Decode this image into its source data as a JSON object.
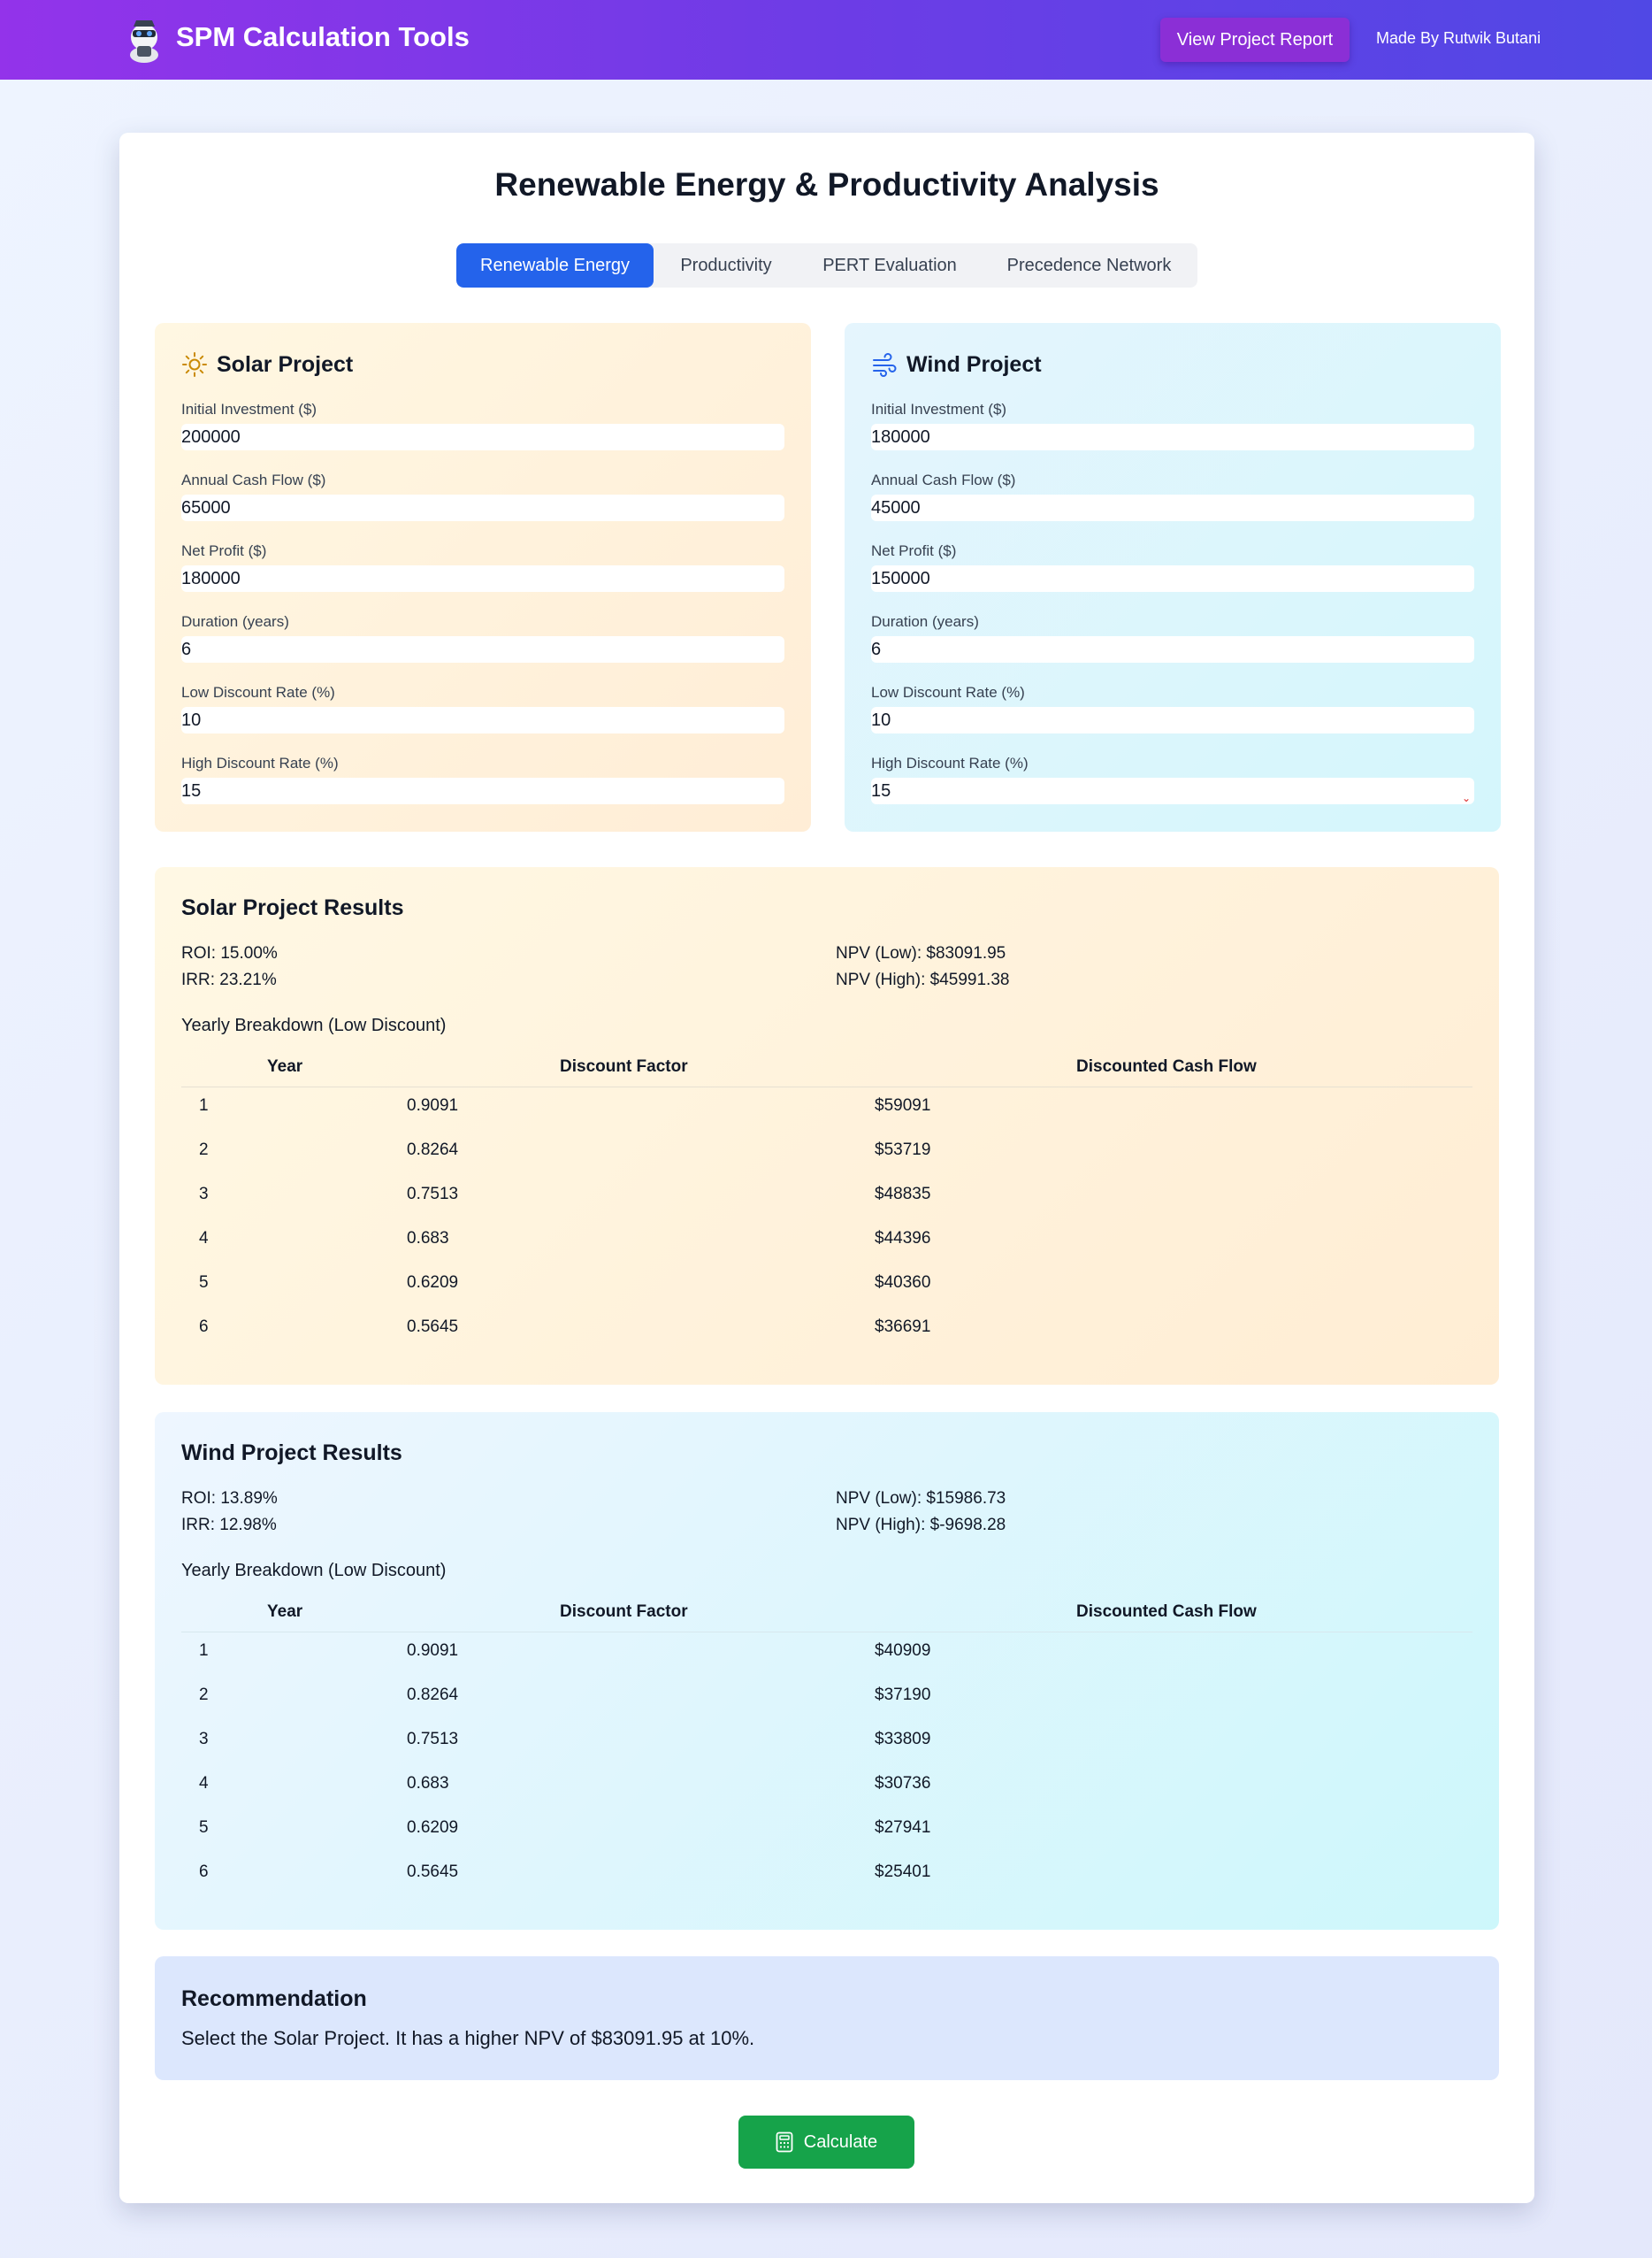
{
  "header": {
    "app_title": "SPM Calculation Tools",
    "report_button": "View Project Report",
    "made_by": "Made By Rutwik Butani"
  },
  "page_title": "Renewable Energy & Productivity Analysis",
  "tabs": [
    {
      "label": "Renewable Energy",
      "active": true
    },
    {
      "label": "Productivity",
      "active": false
    },
    {
      "label": "PERT Evaluation",
      "active": false
    },
    {
      "label": "Precedence Network",
      "active": false
    }
  ],
  "solar_input": {
    "title": "Solar Project",
    "icon": "sun-icon",
    "fields": [
      {
        "label": "Initial Investment ($)",
        "value": "200000"
      },
      {
        "label": "Annual Cash Flow ($)",
        "value": "65000"
      },
      {
        "label": "Net Profit ($)",
        "value": "180000"
      },
      {
        "label": "Duration (years)",
        "value": "6"
      },
      {
        "label": "Low Discount Rate (%)",
        "value": "10"
      },
      {
        "label": "High Discount Rate (%)",
        "value": "15"
      }
    ]
  },
  "wind_input": {
    "title": "Wind Project",
    "icon": "wind-icon",
    "fields": [
      {
        "label": "Initial Investment ($)",
        "value": "180000"
      },
      {
        "label": "Annual Cash Flow ($)",
        "value": "45000"
      },
      {
        "label": "Net Profit ($)",
        "value": "150000"
      },
      {
        "label": "Duration (years)",
        "value": "6"
      },
      {
        "label": "Low Discount Rate (%)",
        "value": "10"
      },
      {
        "label": "High Discount Rate (%)",
        "value": "15"
      }
    ]
  },
  "solar_results": {
    "title": "Solar Project Results",
    "roi": "ROI: 15.00%",
    "irr": "IRR: 23.21%",
    "npv_low": "NPV (Low): $83091.95",
    "npv_high": "NPV (High): $45991.38",
    "breakdown_label": "Yearly Breakdown (Low Discount)",
    "columns": [
      "Year",
      "Discount Factor",
      "Discounted Cash Flow"
    ],
    "rows": [
      [
        "1",
        "0.9091",
        "$59091"
      ],
      [
        "2",
        "0.8264",
        "$53719"
      ],
      [
        "3",
        "0.7513",
        "$48835"
      ],
      [
        "4",
        "0.683",
        "$44396"
      ],
      [
        "5",
        "0.6209",
        "$40360"
      ],
      [
        "6",
        "0.5645",
        "$36691"
      ]
    ]
  },
  "wind_results": {
    "title": "Wind Project Results",
    "roi": "ROI: 13.89%",
    "irr": "IRR: 12.98%",
    "npv_low": "NPV (Low): $15986.73",
    "npv_high": "NPV (High): $-9698.28",
    "breakdown_label": "Yearly Breakdown (Low Discount)",
    "columns": [
      "Year",
      "Discount Factor",
      "Discounted Cash Flow"
    ],
    "rows": [
      [
        "1",
        "0.9091",
        "$40909"
      ],
      [
        "2",
        "0.8264",
        "$37190"
      ],
      [
        "3",
        "0.7513",
        "$33809"
      ],
      [
        "4",
        "0.683",
        "$30736"
      ],
      [
        "5",
        "0.6209",
        "$27941"
      ],
      [
        "6",
        "0.5645",
        "$25401"
      ]
    ]
  },
  "recommendation": {
    "title": "Recommendation",
    "text": "Select the Solar Project. It has a higher NPV of $83091.95 at 10%."
  },
  "calculate_button": "Calculate",
  "colors": {
    "header_start": "#9333ea",
    "header_end": "#5048e5",
    "active_tab": "#2463eb",
    "calculate": "#16a34a"
  }
}
